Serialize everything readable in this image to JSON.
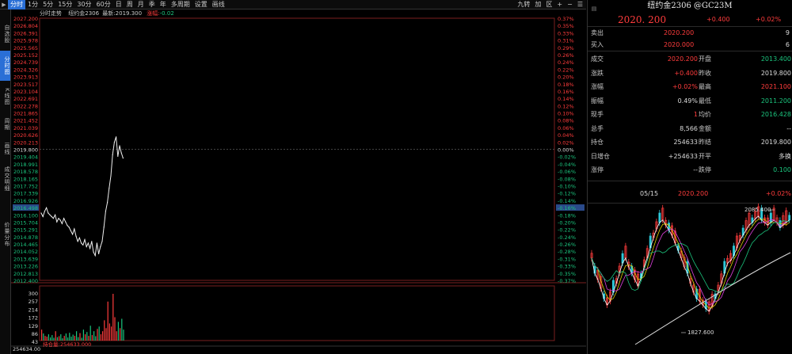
{
  "toolbar": {
    "timeframes": [
      "分时",
      "1分",
      "5分",
      "15分",
      "30分",
      "60分",
      "日",
      "周",
      "月",
      "季",
      "年",
      "多周期",
      "设置",
      "画线"
    ],
    "active_index": 0,
    "right_tools": [
      "九转",
      "加",
      "区",
      "+",
      "−",
      "☰"
    ]
  },
  "side_tabs": [
    {
      "label": "自选股",
      "active": false
    },
    {
      "label": "分时图",
      "active": true
    },
    {
      "label": "K线图",
      "active": false
    },
    {
      "label": "周期",
      "active": false
    },
    {
      "label": "画线",
      "active": false
    },
    {
      "label": "成交明细",
      "active": false
    },
    {
      "label": "价量分布",
      "active": false
    }
  ],
  "chart_header": {
    "title": "分时走势",
    "symbol": "纽约金2306",
    "latest_label": "最新:",
    "latest": "2019.300",
    "change_label": "涨幅:",
    "change": "-0.02"
  },
  "price_axis": [
    "2027.200",
    "2026.804",
    "2026.391",
    "2025.978",
    "2025.565",
    "2025.152",
    "2024.739",
    "2024.326",
    "2023.913",
    "2023.517",
    "2023.104",
    "2022.691",
    "2022.278",
    "2021.865",
    "2021.452",
    "2021.039",
    "2020.626",
    "2020.213",
    "2019.800",
    "2019.404",
    "2018.991",
    "2018.578",
    "2018.165",
    "2017.752",
    "2017.339",
    "2016.926",
    "2016.498",
    "2016.100",
    "2015.704",
    "2015.291",
    "2014.878",
    "2014.465",
    "2014.052",
    "2013.639",
    "2013.226",
    "2012.813",
    "2012.400"
  ],
  "pct_axis": [
    "0.37%",
    "0.35%",
    "0.33%",
    "0.31%",
    "0.29%",
    "0.26%",
    "0.24%",
    "0.22%",
    "0.20%",
    "0.18%",
    "0.16%",
    "0.14%",
    "0.12%",
    "0.10%",
    "0.08%",
    "0.06%",
    "0.04%",
    "0.02%",
    "0.00%",
    "-0.02%",
    "-0.04%",
    "-0.06%",
    "-0.08%",
    "-0.10%",
    "-0.12%",
    "-0.14%",
    "-0.16%",
    "-0.18%",
    "-0.20%",
    "-0.22%",
    "-0.24%",
    "-0.26%",
    "-0.28%",
    "-0.31%",
    "-0.33%",
    "-0.35%",
    "-0.37%"
  ],
  "price_axis_highlight": "2016.498",
  "pct_axis_highlight": "-0.16%",
  "volume_axis": [
    "300",
    "257",
    "214",
    "172",
    "129",
    "86",
    "43"
  ],
  "volume_footer": {
    "open_interest_label": "254634.00",
    "position_label": "持仓量:",
    "position_value": "254633.000"
  },
  "quote": {
    "title": "纽约金2306 @GC23M",
    "last": "2020. 200",
    "change": "+0.400",
    "pct": "+0.02%",
    "ask_label": "卖出",
    "ask": "2020.200",
    "ask_vol": "9",
    "bid_label": "买入",
    "bid": "2020.000",
    "bid_vol": "6",
    "rows": [
      {
        "l1": "成交",
        "v1": "2020.200",
        "c1": "red",
        "l2": "开盘",
        "v2": "2013.400",
        "c2": "grn"
      },
      {
        "l1": "涨跌",
        "v1": "+0.400",
        "c1": "red",
        "l2": "昨收",
        "v2": "2019.800",
        "c2": "wht"
      },
      {
        "l1": "涨幅",
        "v1": "+0.02%",
        "c1": "red",
        "l2": "最高",
        "v2": "2021.100",
        "c2": "red"
      },
      {
        "l1": "振幅",
        "v1": "0.49%",
        "c1": "wht",
        "l2": "最低",
        "v2": "2011.200",
        "c2": "grn"
      },
      {
        "l1": "现手",
        "v1": "1",
        "c1": "red",
        "l2": "均价",
        "v2": "2016.428",
        "c2": "grn"
      },
      {
        "l1": "总手",
        "v1": "8,566",
        "c1": "wht",
        "l2": "金额",
        "v2": "--",
        "c2": "wht"
      },
      {
        "l1": "持仓",
        "v1": "254633",
        "c1": "wht",
        "l2": "昨结",
        "v2": "2019.800",
        "c2": "wht"
      },
      {
        "l1": "日增仓",
        "v1": "+254633",
        "c1": "wht",
        "l2": "开平",
        "v2": "多换",
        "c2": "wht"
      },
      {
        "l1": "涨停",
        "v1": "--",
        "c1": "wht",
        "l2": "跌停",
        "v2": "0.100",
        "c2": "grn"
      }
    ],
    "tick": {
      "date": "05/15",
      "price": "2020.200",
      "pct": "+0.02%"
    }
  },
  "mini_kline": {
    "high_label": "2085.400",
    "low_label": "1827.600"
  },
  "colors": {
    "up": "#ff3c3c",
    "down": "#1bc47d",
    "accent": "#2a6fd6",
    "grid": "#7a1f1f"
  },
  "chart_data": {
    "type": "line",
    "ylim": [
      2012.4,
      2027.2
    ],
    "prev_close": 2019.8,
    "price": [
      2016.2,
      2016.0,
      2016.3,
      2016.5,
      2016.2,
      2016.1,
      2016.0,
      2015.9,
      2016.1,
      2015.7,
      2015.9,
      2015.8,
      2015.6,
      2015.9,
      2015.7,
      2015.5,
      2015.4,
      2015.2,
      2015.0,
      2015.3,
      2014.9,
      2014.6,
      2014.8,
      2014.5,
      2014.4,
      2014.7,
      2014.3,
      2014.5,
      2014.2,
      2014.6,
      2014.0,
      2013.8,
      2014.5,
      2013.9,
      2014.3,
      2014.6,
      2015.4,
      2016.3,
      2016.8,
      2017.6,
      2018.3,
      2019.5,
      2020.2,
      2020.5,
      2019.4,
      2020.0,
      2019.6,
      2019.3
    ],
    "volume": [
      70,
      45,
      30,
      25,
      40,
      20,
      35,
      18,
      60,
      22,
      28,
      40,
      15,
      30,
      45,
      20,
      50,
      25,
      38,
      30,
      60,
      22,
      48,
      18,
      70,
      40,
      55,
      30,
      95,
      35,
      60,
      28,
      75,
      90,
      40,
      60,
      130,
      80,
      250,
      110,
      90,
      300,
      150,
      60,
      120,
      80,
      140,
      70
    ]
  }
}
